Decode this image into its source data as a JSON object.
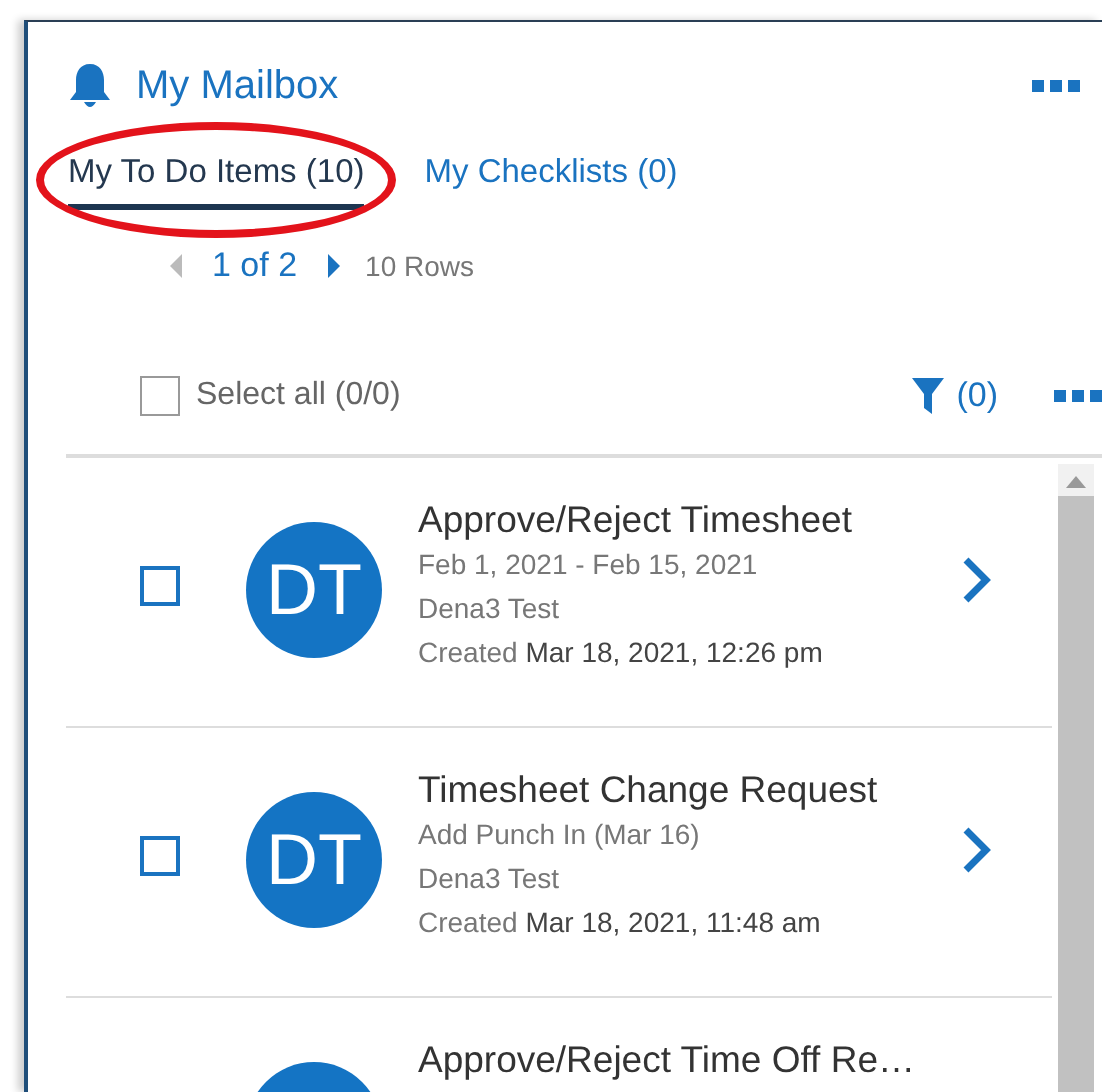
{
  "header": {
    "title": "My Mailbox"
  },
  "tabs": [
    {
      "label": "My To Do Items (10)",
      "selected": true,
      "circled": true
    },
    {
      "label": "My Checklists (0)",
      "selected": false,
      "circled": false
    }
  ],
  "pager": {
    "page": "1 of 2",
    "rows": "10 Rows",
    "prev_disabled": true,
    "next_disabled": false
  },
  "toolbar": {
    "select_all": {
      "label": "Select all (0/0)",
      "checked": false
    },
    "filter_count": "(0)"
  },
  "items": [
    {
      "initials": "DT",
      "title": "Approve/Reject Timesheet",
      "lines": [
        "Feb 1, 2021 - Feb 15, 2021",
        "Dena3 Test"
      ],
      "created": "Created **Mar 18, 2021, 12:26 pm**",
      "checked": false
    },
    {
      "initials": "DT",
      "title": "Timesheet Change Request",
      "lines": [
        "Add Punch In (Mar 16)",
        "Dena3 Test"
      ],
      "created": "Created **Mar 18, 2021, 11:48 am**",
      "checked": false
    },
    {
      "title": "Approve/Reject Time Off Re…"
    }
  ]
}
